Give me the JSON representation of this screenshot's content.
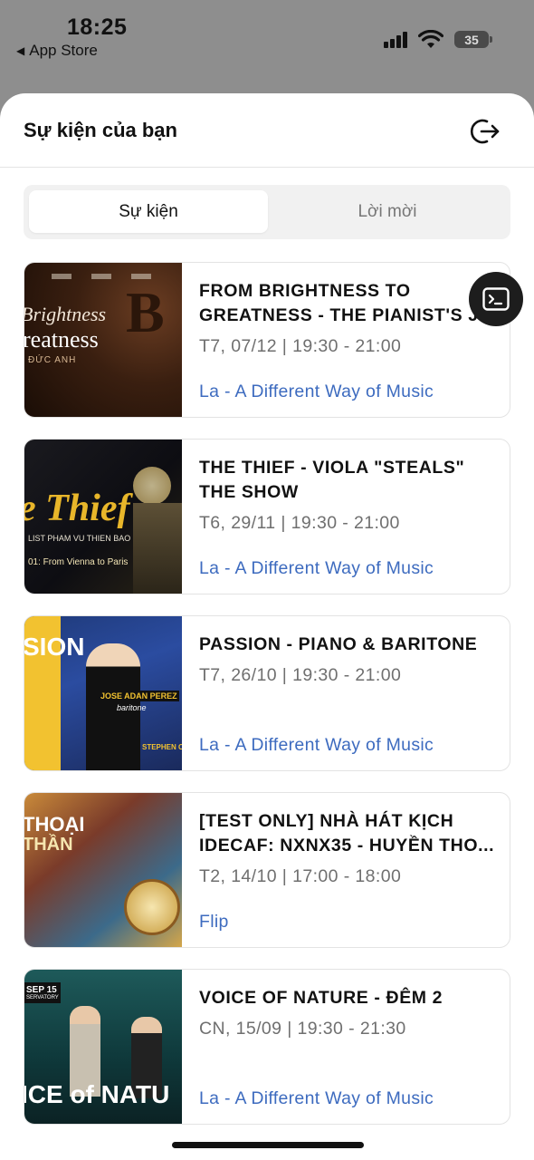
{
  "status_bar": {
    "time": "18:25",
    "back_label": "App Store",
    "battery": "35",
    "icons": [
      "signal-icon",
      "wifi-icon",
      "battery-icon"
    ]
  },
  "header": {
    "title": "Sự kiện của bạn",
    "exit_icon": "logout-icon"
  },
  "tabs": [
    {
      "label": "Sự kiện",
      "active": true
    },
    {
      "label": "Lời mời",
      "active": false
    }
  ],
  "colors": {
    "accent_link": "#3d6bbf",
    "muted_text": "#6f6f6f"
  },
  "events": [
    {
      "title": "FROM BRIGHTNESS TO GREATNESS - THE PIANIST'S J...",
      "time": "T7, 07/12 | 19:30 - 21:00",
      "organizer": "La - A Different Way of Music",
      "thumb": {
        "line1": "Brightness",
        "line2": "reatness",
        "sub": "ĐỨC ANH"
      }
    },
    {
      "title": "THE THIEF - VIOLA \"STEALS\" THE SHOW",
      "time": "T6, 29/11 | 19:30 - 21:00",
      "organizer": "La - A Different Way of Music",
      "thumb": {
        "line1": "e Thief",
        "sub": "LIST PHAM VU THIEN BAO",
        "sub2": "01: From Vienna to Paris"
      }
    },
    {
      "title": "PASSION - PIANO & BARITONE",
      "time": "T7, 26/10 | 19:30 - 21:00",
      "organizer": "La - A Different Way of Music",
      "thumb": {
        "line1": "SION",
        "name": "JOSE ADAN PEREZ",
        "role": "baritone",
        "name2": "STEPHEN OL"
      }
    },
    {
      "title": "[TEST ONLY] NHÀ HÁT KỊCH IDECAF: NXNX35 - HUYỀN THO...",
      "time": "T2, 14/10 | 17:00 - 18:00",
      "organizer": "Flip",
      "thumb": {
        "line1": "THOẠI",
        "line2": "THẦN"
      }
    },
    {
      "title": "VOICE OF NATURE - ĐÊM 2",
      "time": "CN, 15/09 | 19:30 - 21:30",
      "organizer": "La - A Different Way of Music",
      "thumb": {
        "line1": "ICE of NATU",
        "badge": "SEP 15",
        "badge_sub": "SERVATORY"
      }
    }
  ]
}
